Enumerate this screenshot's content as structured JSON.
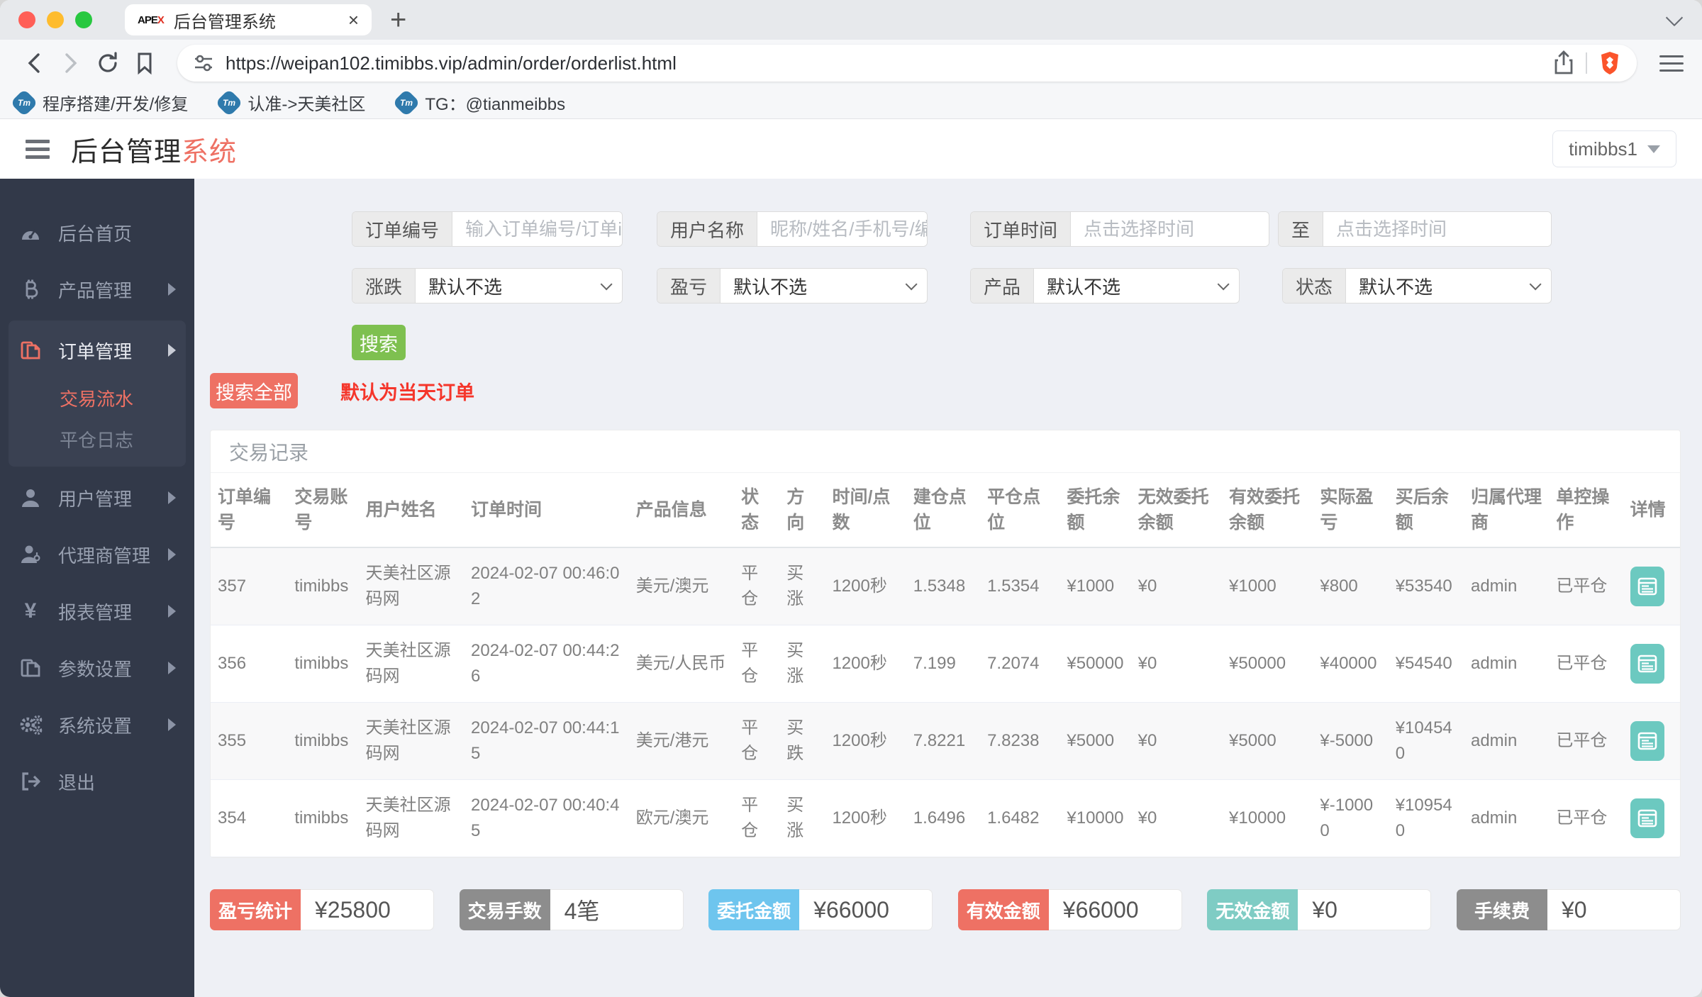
{
  "colors": {
    "accent": "#ee7164",
    "red": "#f5362b",
    "green": "#35a843",
    "teal": "#6cc9c0",
    "blue": "#6ec5ee",
    "gray_label": "#8d8d8d",
    "green_button": "#7ec050",
    "sidebar_bg": "#323949"
  },
  "browser": {
    "tab_title": "后台管理系统",
    "favicon_text": "APE",
    "favicon_x": "X",
    "new_tab": "+",
    "close_tab": "×",
    "url": "https://weipan102.timibbs.vip/admin/order/orderlist.html",
    "bookmarks": [
      {
        "icon": "Tm",
        "label": "程序搭建/开发/修复"
      },
      {
        "icon": "Tm",
        "label": "认准->天美社区"
      },
      {
        "icon": "Tm",
        "label": "TG：@tianmeibbs"
      }
    ]
  },
  "header": {
    "title_black": "后台管理",
    "title_red": "系统",
    "user": "timibbs1"
  },
  "sidebar": {
    "items": [
      {
        "label": "后台首页"
      },
      {
        "label": "产品管理"
      },
      {
        "label": "订单管理"
      },
      {
        "label": "用户管理"
      },
      {
        "label": "代理商管理"
      },
      {
        "label": "报表管理"
      },
      {
        "label": "参数设置"
      },
      {
        "label": "系统设置"
      },
      {
        "label": "退出"
      }
    ],
    "submenu": [
      {
        "label": "交易流水",
        "active": true
      },
      {
        "label": "平仓日志",
        "active": false
      }
    ]
  },
  "filters": {
    "order_no": {
      "label": "订单编号",
      "placeholder": "输入订单编号/订单id"
    },
    "user_name": {
      "label": "用户名称",
      "placeholder": "昵称/姓名/手机号/编号"
    },
    "order_time": {
      "label": "订单时间",
      "placeholder_from": "点击选择时间",
      "to_label": "至",
      "placeholder_to": "点击选择时间"
    },
    "updown": {
      "label": "涨跌",
      "value": "默认不选"
    },
    "profit": {
      "label": "盈亏",
      "value": "默认不选"
    },
    "product": {
      "label": "产品",
      "value": "默认不选"
    },
    "status": {
      "label": "状态",
      "value": "默认不选"
    },
    "search_button": "搜索",
    "search_all_button": "搜索全部",
    "hint": "默认为当天订单"
  },
  "table": {
    "title": "交易记录",
    "headers": [
      "订单编号",
      "交易账号",
      "用户姓名",
      "订单时间",
      "产品信息",
      "状态",
      "方向",
      "时间/点数",
      "建仓点位",
      "平仓点位",
      "委托余额",
      "无效委托余额",
      "有效委托余额",
      "实际盈亏",
      "买后余额",
      "归属代理商",
      "单控操作",
      "详情"
    ],
    "rows": [
      {
        "order_no": "357",
        "account": "timibbs",
        "user": "天美社区源码网",
        "time": "2024-02-07 00:46:02",
        "product": "美元/澳元",
        "status": "平仓",
        "direction": "买涨",
        "direction_color": "red",
        "duration": "1200秒",
        "open": "1.5348",
        "close": "1.5354",
        "close_color": "red",
        "entrust": "¥1000",
        "invalid": "¥0",
        "valid": "¥1000",
        "profit": "¥800",
        "profit_color": "red",
        "balance": "¥53540",
        "agent": "admin",
        "control": "已平仓"
      },
      {
        "order_no": "356",
        "account": "timibbs",
        "user": "天美社区源码网",
        "time": "2024-02-07 00:44:26",
        "product": "美元/人民币",
        "status": "平仓",
        "direction": "买涨",
        "direction_color": "red",
        "duration": "1200秒",
        "open": "7.199",
        "close": "7.2074",
        "close_color": "red",
        "entrust": "¥50000",
        "invalid": "¥0",
        "valid": "¥50000",
        "profit": "¥40000",
        "profit_color": "red",
        "balance": "¥54540",
        "agent": "admin",
        "control": "已平仓"
      },
      {
        "order_no": "355",
        "account": "timibbs",
        "user": "天美社区源码网",
        "time": "2024-02-07 00:44:15",
        "product": "美元/港元",
        "status": "平仓",
        "direction": "买跌",
        "direction_color": "green",
        "duration": "1200秒",
        "open": "7.8221",
        "close": "7.8238",
        "close_color": "red",
        "entrust": "¥5000",
        "invalid": "¥0",
        "valid": "¥5000",
        "profit": "¥-5000",
        "profit_color": "green",
        "balance": "¥104540",
        "agent": "admin",
        "control": "已平仓"
      },
      {
        "order_no": "354",
        "account": "timibbs",
        "user": "天美社区源码网",
        "time": "2024-02-07 00:40:45",
        "product": "欧元/澳元",
        "status": "平仓",
        "direction": "买涨",
        "direction_color": "red",
        "duration": "1200秒",
        "open": "1.6496",
        "close": "1.6482",
        "close_color": "green",
        "entrust": "¥10000",
        "invalid": "¥0",
        "valid": "¥10000",
        "profit": "¥-10000",
        "profit_color": "green",
        "balance": "¥109540",
        "agent": "admin",
        "control": "已平仓"
      }
    ]
  },
  "summary": [
    {
      "label": "盈亏统计",
      "value": "¥25800",
      "color": "#ee7164"
    },
    {
      "label": "交易手数",
      "value": "4笔",
      "color": "#8d8d8d"
    },
    {
      "label": "委托金额",
      "value": "¥66000",
      "color": "#6ec5ee"
    },
    {
      "label": "有效金额",
      "value": "¥66000",
      "color": "#ee7164"
    },
    {
      "label": "无效金额",
      "value": "¥0",
      "color": "#7fccc4"
    },
    {
      "label": "手续费",
      "value": "¥0",
      "color": "#8d8d8d"
    }
  ]
}
